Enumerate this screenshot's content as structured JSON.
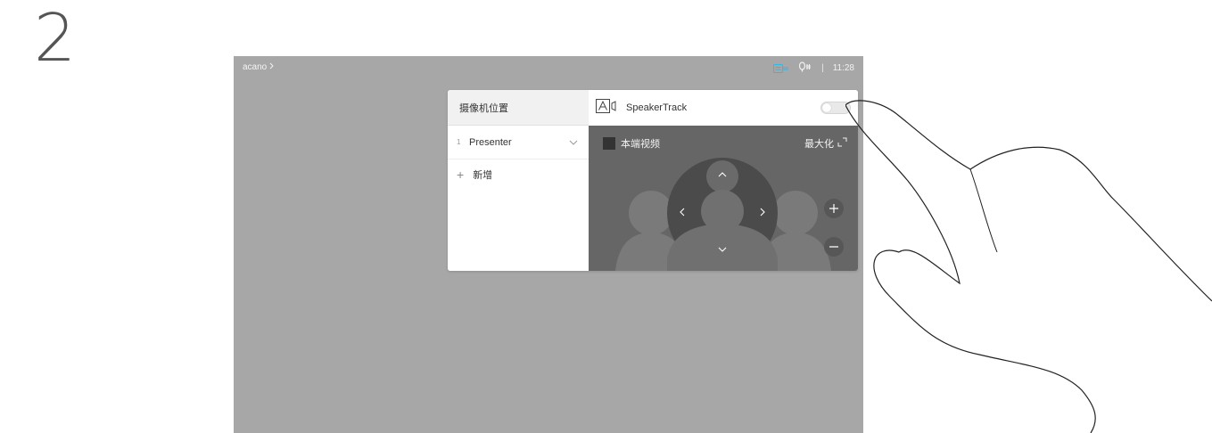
{
  "step": "2",
  "top_bar": {
    "brand": "acano",
    "time": "11:28",
    "divider": "|"
  },
  "panel": {
    "header": "摄像机位置",
    "presets": [
      {
        "index": "1",
        "name": "Presenter"
      }
    ],
    "add_label": "新增",
    "speakertrack": {
      "label": "SpeakerTrack",
      "enabled": false
    },
    "self_view_label": "本端视频",
    "maximize_label": "最大化"
  },
  "colors": {
    "screen_bg": "#a7a7a7",
    "video_bg": "#666666",
    "status_accent": "#37b6e0"
  },
  "icons": {
    "breadcrumb": "chevron-right-icon",
    "camera_status": "camera-icon",
    "mic_status": "microphone-icon",
    "speakertrack": "speakertrack-icon",
    "maximize": "maximize-icon",
    "hand": "pointing-hand"
  }
}
